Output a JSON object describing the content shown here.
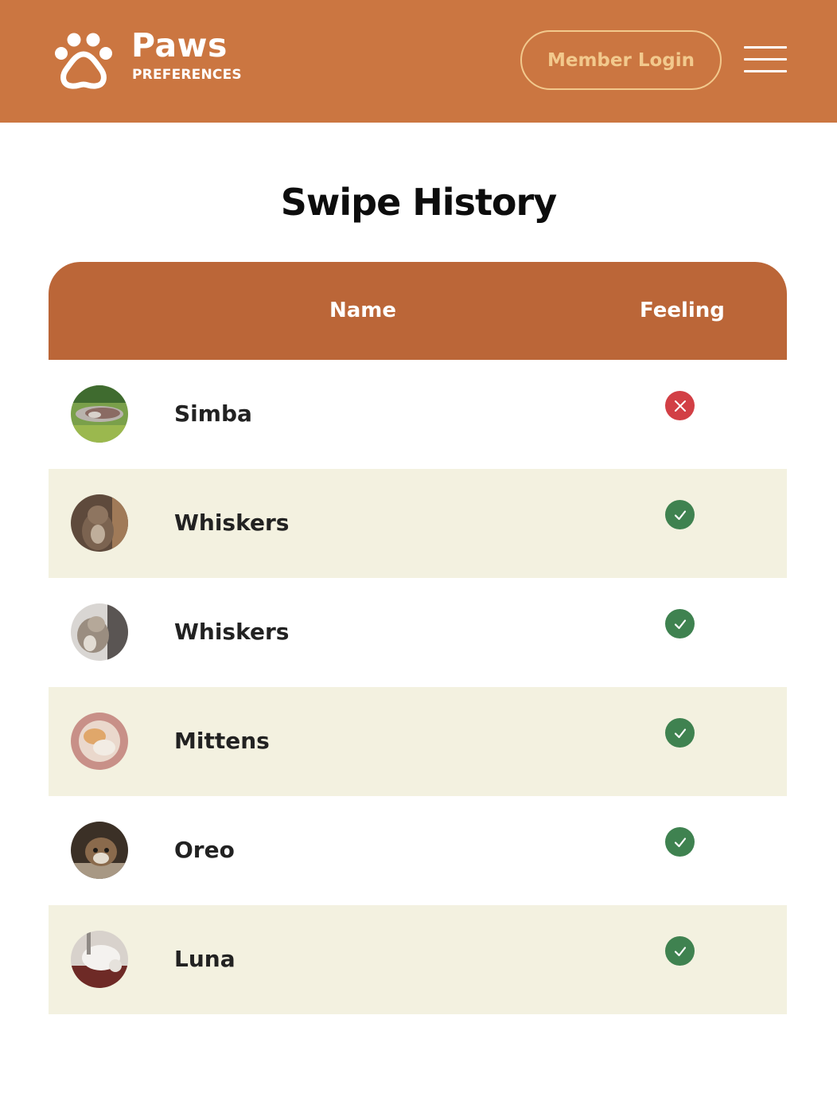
{
  "header": {
    "brand_name": "Paws",
    "brand_sub": "PREFERENCES",
    "login_label": "Member Login",
    "logo_icon": "paw-icon",
    "menu_icon": "hamburger-menu-icon"
  },
  "page": {
    "title": "Swipe History"
  },
  "table": {
    "columns": [
      "",
      "Name",
      "Feeling"
    ],
    "rows": [
      {
        "name": "Simba",
        "feeling": "dislike",
        "feeling_icon": "x-circle-icon"
      },
      {
        "name": "Whiskers",
        "feeling": "like",
        "feeling_icon": "check-circle-icon"
      },
      {
        "name": "Whiskers",
        "feeling": "like",
        "feeling_icon": "check-circle-icon"
      },
      {
        "name": "Mittens",
        "feeling": "like",
        "feeling_icon": "check-circle-icon"
      },
      {
        "name": "Oreo",
        "feeling": "like",
        "feeling_icon": "check-circle-icon"
      },
      {
        "name": "Luna",
        "feeling": "like",
        "feeling_icon": "check-circle-icon"
      }
    ]
  },
  "colors": {
    "header_bg": "#cb7641",
    "table_header_bg": "#bb6638",
    "login_accent": "#f2c98d",
    "row_alt_bg": "#f3f1e0",
    "like": "#3f8250",
    "dislike": "#d23f45"
  }
}
